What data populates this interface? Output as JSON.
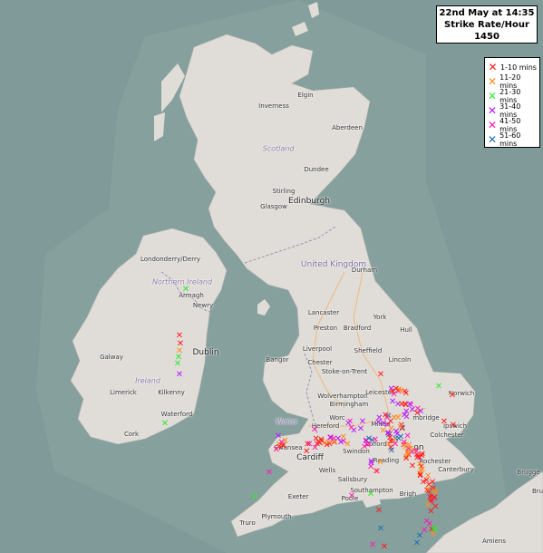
{
  "info": {
    "line1": "22nd May at 14:35",
    "line2": "Strike Rate/Hour",
    "line3": "1450"
  },
  "legend": [
    {
      "label": "1-10 mins",
      "color": "#ff1a1a"
    },
    {
      "label": "11-20 mins",
      "color": "#ff8c1a"
    },
    {
      "label": "21-30 mins",
      "color": "#33e633"
    },
    {
      "label": "31-40 mins",
      "color": "#b31aff"
    },
    {
      "label": "41-50 mins",
      "color": "#ff1ab3"
    },
    {
      "label": "51-60 mins",
      "color": "#1a6fb3"
    }
  ],
  "colors": {
    "sea": "#7f9a98",
    "land": "#e0ddd8",
    "border": "#9b8db5"
  },
  "places": {
    "elgin": "Elgin",
    "inverness": "Inverness",
    "aberdeen": "Aberdeen",
    "scotland": "Scotland",
    "dundee": "Dundee",
    "stirling": "Stirling",
    "edinburgh": "Edinburgh",
    "glasgow": "Glasgow",
    "londonderry": "Londonderry/Derry",
    "united_kingdom": "United Kingdom",
    "durham": "Durham",
    "northern_ireland": "Northern Ireland",
    "armagh": "Armagh",
    "newry": "Newry",
    "lancaster": "Lancaster",
    "york": "York",
    "preston": "Preston",
    "bradford": "Bradford",
    "hull": "Hull",
    "dublin": "Dublin",
    "liverpool": "Liverpool",
    "sheffield": "Sheffield",
    "galway": "Galway",
    "bangor": "Bangor",
    "chester": "Chester",
    "lincoln": "Lincoln",
    "stoke": "Stoke-on-Trent",
    "ireland": "Ireland",
    "limerick": "Limerick",
    "kilkenny": "Kilkenny",
    "wolverhampton": "Wolverhampton",
    "leicester": "Leicester",
    "norwich": "Norwich",
    "birmingham": "Birmingham",
    "waterford": "Waterford",
    "wales": "Wales",
    "hereford": "Hereford",
    "worcester": "Worc",
    "milton": "Milton",
    "cambridge": "mbridge",
    "ipswich": "Ipswich",
    "cork": "Cork",
    "oxford": "Oxford",
    "colchester": "Colchester",
    "swansea": "Swansea",
    "cardiff": "Cardiff",
    "swindon": "Swindon",
    "london": "on",
    "wells": "Wells",
    "reading": "Reading",
    "rochester": "Rochester",
    "canterbury": "Canterbury",
    "salisbury": "Salisbury",
    "exeter": "Exeter",
    "southampton": "Southampton",
    "brighton": "Brigh",
    "poole": "Poole",
    "plymouth": "Plymouth",
    "truro": "Truro",
    "bruges": "Brugge",
    "amiens": "Amiens",
    "bruxelles": "Bru"
  }
}
